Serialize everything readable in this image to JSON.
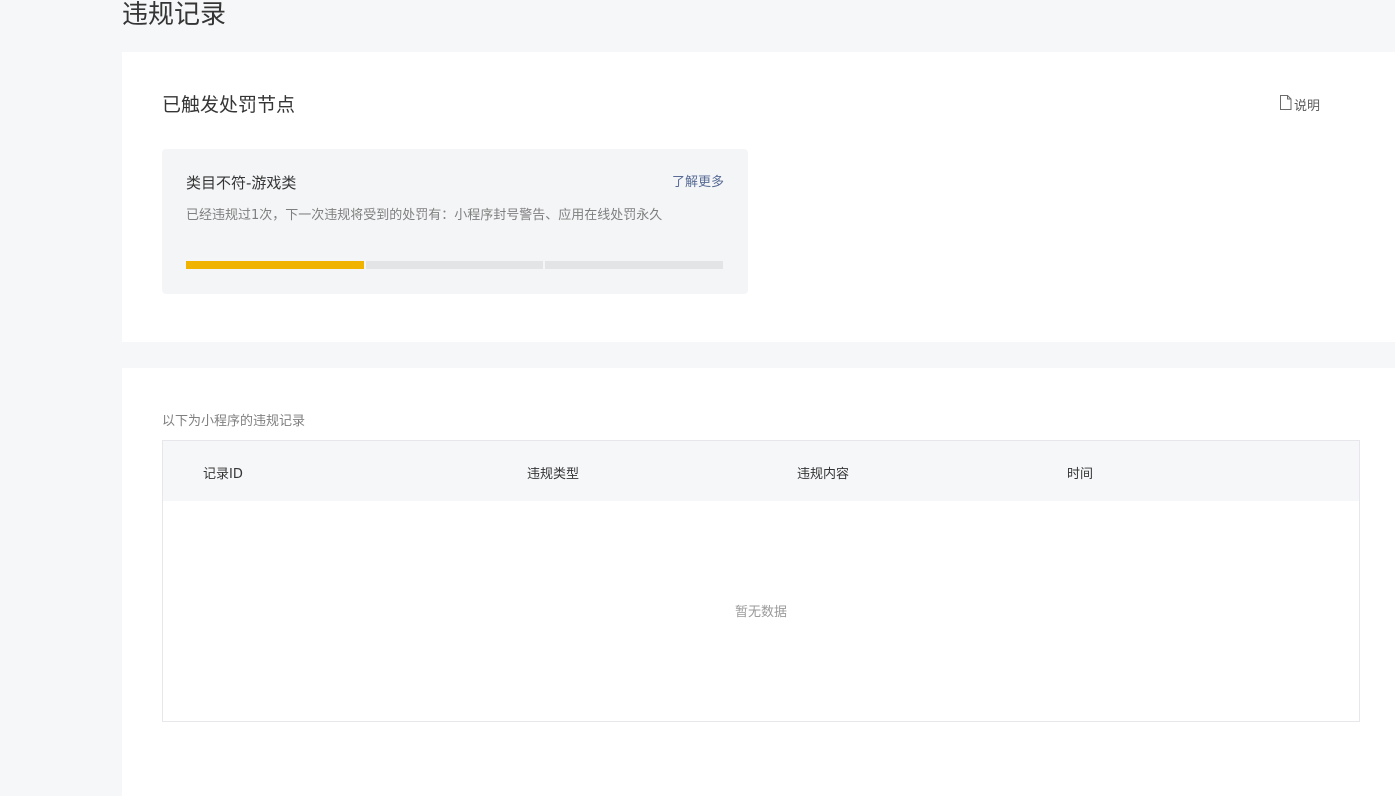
{
  "page": {
    "title": "违规记录"
  },
  "penalty": {
    "section_title": "已触发处罚节点",
    "explain_label": "说明",
    "explain_icon": "document-icon",
    "card": {
      "title": "类目不符-游戏类",
      "more_label": "了解更多",
      "description": "已经违规过1次，下一次违规将受到的处罚有：小程序封号警告、应用在线处罚永久",
      "progress_total_segments": 3,
      "progress_active_segments": 1,
      "progress_color": "#f0b400"
    }
  },
  "records": {
    "caption": "以下为小程序的违规记录",
    "columns": [
      "记录ID",
      "违规类型",
      "违规内容",
      "时间"
    ],
    "rows": [],
    "empty_text": "暂无数据"
  },
  "colors": {
    "link": "#576b95",
    "background": "#f6f7f9",
    "card_background": "#f4f5f7"
  }
}
